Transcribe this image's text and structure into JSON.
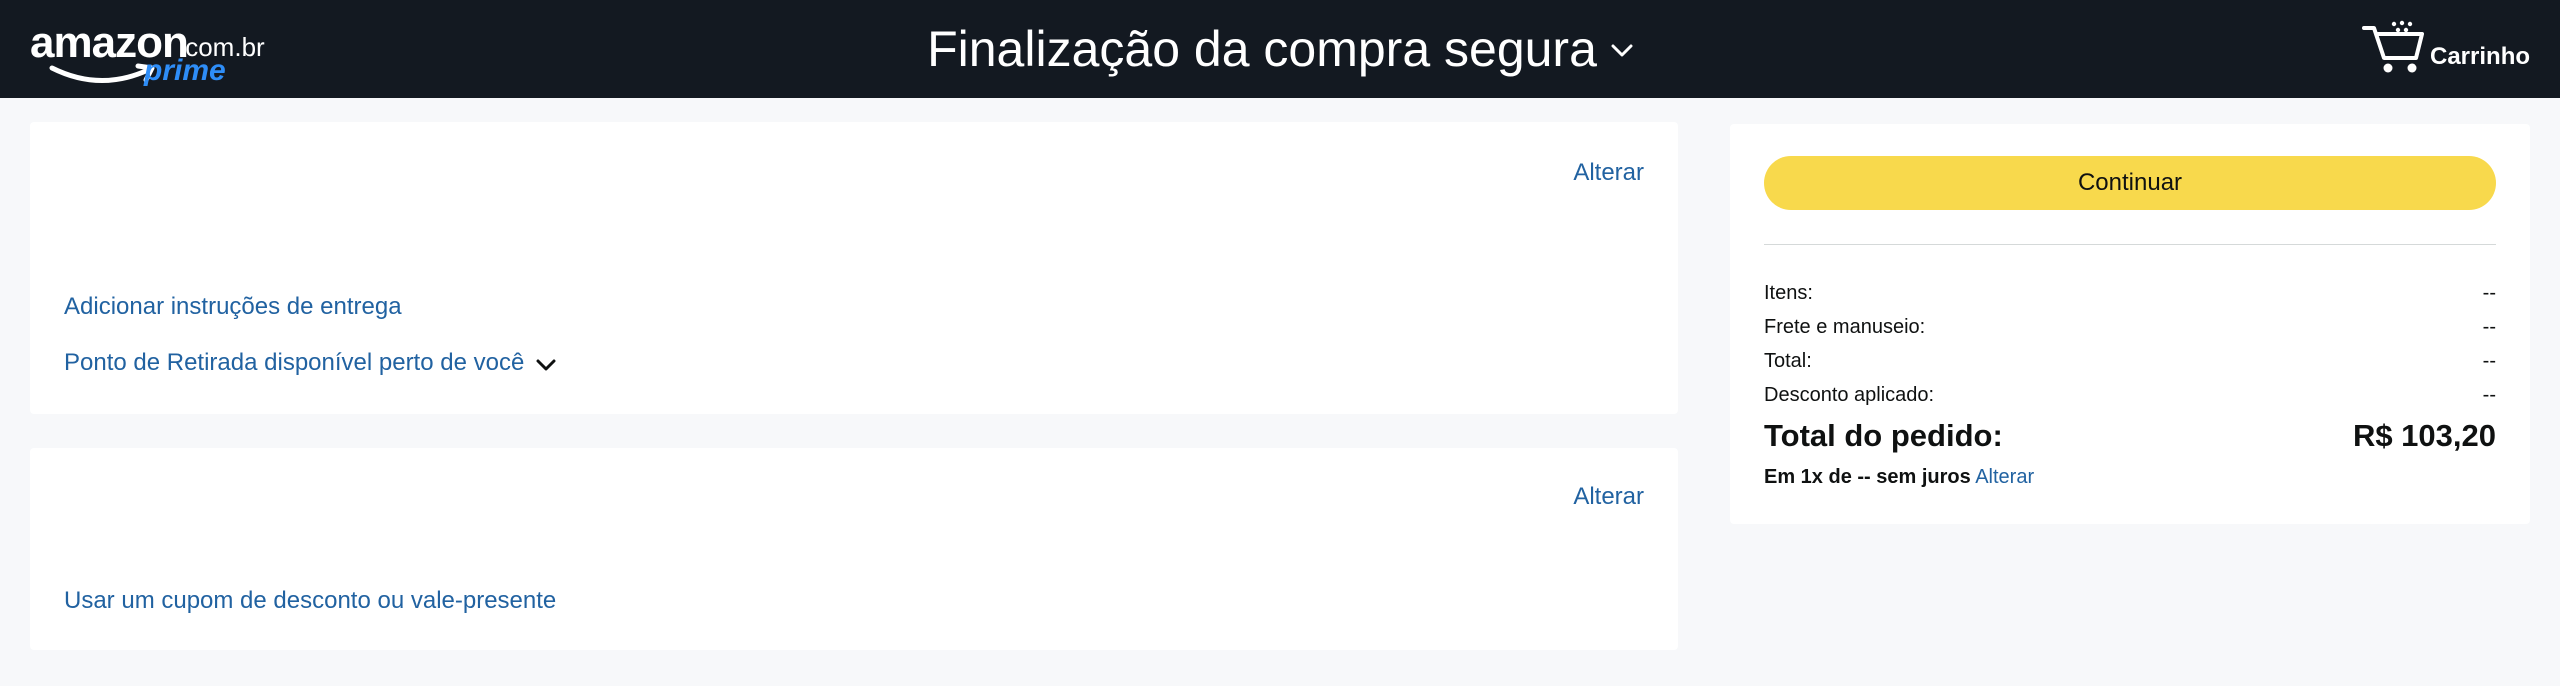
{
  "header": {
    "logo": {
      "word": "amazon",
      "domain": ".com.br",
      "prime": "prime"
    },
    "title": "Finalização da compra segura",
    "cart_label": "Carrinho"
  },
  "delivery_card": {
    "change_label": "Alterar",
    "instructions_link": "Adicionar instruções de entrega",
    "pickup_link": "Ponto de Retirada disponível perto de você"
  },
  "payment_card": {
    "change_label": "Alterar",
    "coupon_link": "Usar um cupom de desconto ou vale-presente"
  },
  "summary": {
    "continue_button": "Continuar",
    "rows": [
      {
        "label": "Itens:",
        "value": "--"
      },
      {
        "label": "Frete e manuseio:",
        "value": "--"
      },
      {
        "label": "Total:",
        "value": "--"
      },
      {
        "label": "Desconto aplicado:",
        "value": "--"
      }
    ],
    "order_total_label": "Total do pedido:",
    "order_total_value": "R$ 103,20",
    "installment_text": "Em 1x de -- sem juros",
    "installment_change": "Alterar"
  },
  "colors": {
    "header_bg": "#131921",
    "button_yellow": "#f8d94c",
    "link_blue": "#2162a1",
    "prime_blue": "#2e8df7"
  }
}
